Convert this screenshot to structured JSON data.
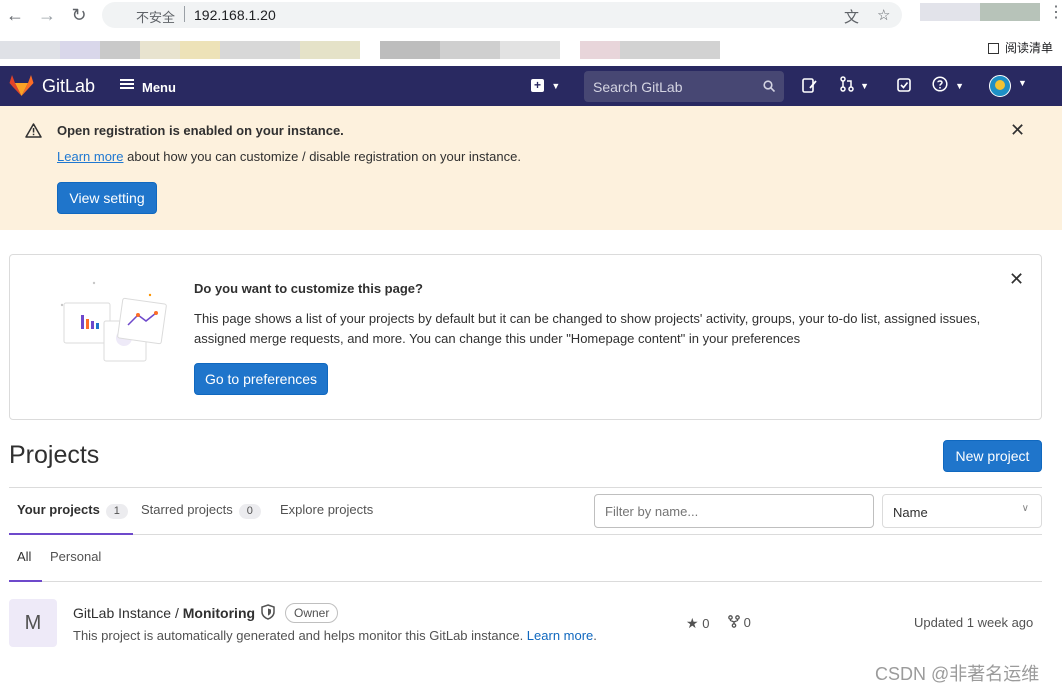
{
  "browser": {
    "security_label": "不安全",
    "url": "192.168.1.20",
    "reading_list": "阅读清单"
  },
  "header": {
    "brand": "GitLab",
    "menu_label": "Menu",
    "search_placeholder": "Search GitLab"
  },
  "registration_alert": {
    "title": "Open registration is enabled on your instance.",
    "link_text": "Learn more",
    "body_rest": " about how you can customize / disable registration on your instance.",
    "button_label": "View setting"
  },
  "customize_card": {
    "title": "Do you want to customize this page?",
    "body": "This page shows a list of your projects by default but it can be changed to show projects' activity, groups, your to-do list, assigned issues, assigned merge requests, and more. You can change this under \"Homepage content\" in your preferences",
    "button_label": "Go to preferences"
  },
  "projects": {
    "title": "Projects",
    "new_button": "New project",
    "tabs": [
      {
        "label": "Your projects",
        "count": "1"
      },
      {
        "label": "Starred projects",
        "count": "0"
      },
      {
        "label": "Explore projects"
      }
    ],
    "filter_placeholder": "Filter by name...",
    "sort_value": "Name",
    "subtabs": [
      "All",
      "Personal"
    ],
    "items": [
      {
        "avatar_letter": "M",
        "namespace": "GitLab Instance / ",
        "name": "Monitoring",
        "role": "Owner",
        "description": "This project is automatically generated and helps monitor this GitLab instance. ",
        "description_link": "Learn more",
        "description_end": ".",
        "stars": "0",
        "forks": "0",
        "updated": "Updated 1 week ago"
      }
    ]
  },
  "watermark": "CSDN @非著名运维",
  "colors": {
    "header_bg": "#292961",
    "alert_bg": "#fdf1dd",
    "primary": "#1f75cb",
    "tab_accent": "#6e49cb"
  }
}
